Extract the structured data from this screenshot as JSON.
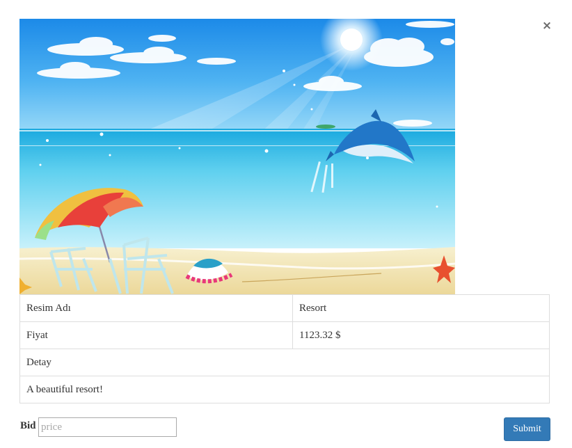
{
  "modal": {
    "close_symbol": "×"
  },
  "image": {
    "alt": "Beach resort illustration with umbrella, chairs, and jumping dolphin",
    "icon": "beach-resort-image"
  },
  "details": {
    "name_label": "Resim Adı",
    "name_value": "Resort",
    "price_label": "Fiyat",
    "price_value": "1123.32 $",
    "detail_label": "Detay",
    "detail_value": "A beautiful resort!"
  },
  "bid": {
    "label": "Bid",
    "placeholder": "price",
    "value": "",
    "submit_label": "Submit"
  },
  "colors": {
    "button": "#337ab7",
    "border": "#dddddd",
    "text": "#333333"
  }
}
